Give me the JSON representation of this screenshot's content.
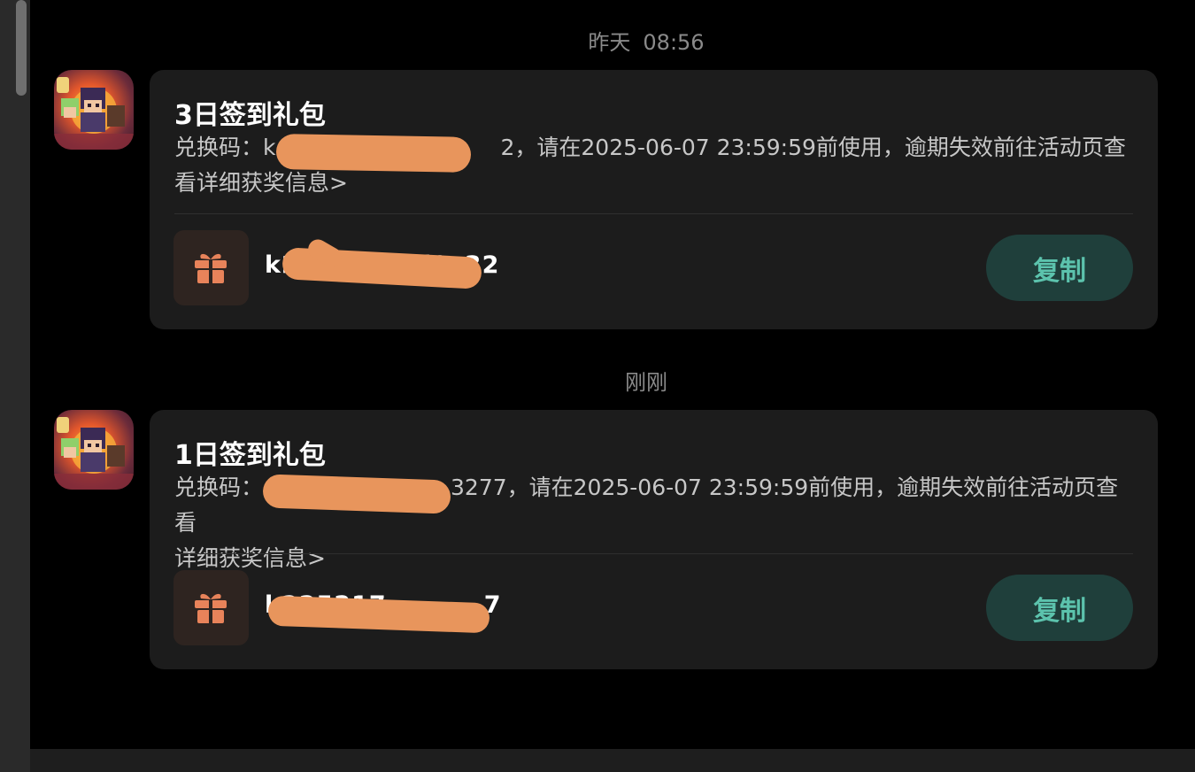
{
  "messages": [
    {
      "timestamp_day": "昨天",
      "timestamp_time": "08:56",
      "title": "3日签到礼包",
      "description_prefix": "兑换码：k",
      "description_visible_tail": "2",
      "description_line1": "，请在2025-06-07 23:59:59前使用，逾期失效前往活动页查",
      "description_line2": "看详细获奖信息>",
      "code_visible": "k2",
      "code_tail": "l9c32",
      "copy_label": "复制",
      "gift_icon_color": "#e8835a"
    },
    {
      "timestamp_day": "刚刚",
      "timestamp_time": "",
      "title": "1日签到礼包",
      "description_prefix": "兑换码：",
      "description_visible_tail": "3277",
      "description_line1": "，请在2025-06-07 23:59:59前使用，逾期失效前往活动页查看",
      "description_line2": "详细获奖信息>",
      "code_visible": "k225217",
      "code_tail": "7",
      "copy_label": "复制",
      "gift_icon_color": "#e8835a"
    }
  ],
  "colors": {
    "background": "#000000",
    "card": "#1c1c1c",
    "copy_button_bg": "#1f3f3b",
    "copy_button_text": "#5cc3ad",
    "redaction": "#e8955c"
  }
}
